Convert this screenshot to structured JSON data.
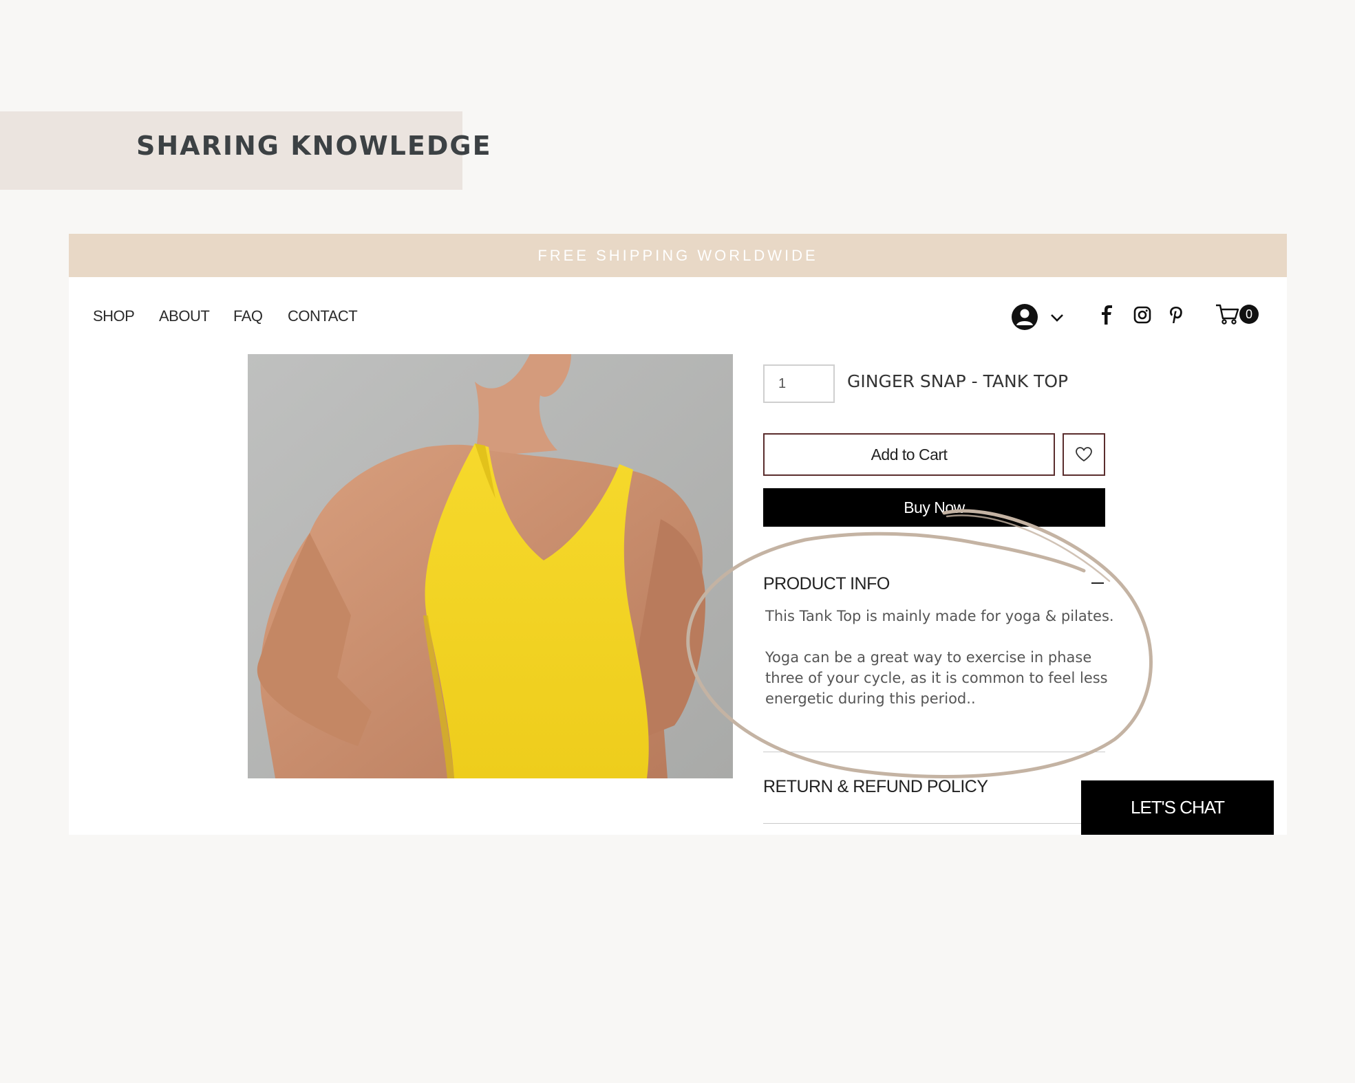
{
  "slide": {
    "title": "SHARING KNOWLEDGE"
  },
  "store": {
    "banner": "FREE SHIPPING WORLDWIDE",
    "nav": [
      "SHOP",
      "ABOUT",
      "FAQ",
      "CONTACT"
    ],
    "cart_count": "0",
    "icons": [
      "account-icon",
      "chevron-down-icon",
      "facebook-icon",
      "instagram-icon",
      "pinterest-icon",
      "cart-icon",
      "heart-icon",
      "minus-icon"
    ]
  },
  "product": {
    "quantity": "1",
    "title": "GINGER SNAP - TANK TOP",
    "add_to_cart": "Add to Cart",
    "buy_now": "Buy Now",
    "info_title": "PRODUCT INFO",
    "info_p1": "This Tank Top is mainly made for yoga & pilates.",
    "info_p2": "Yoga can be a great way to exercise in phase three of your cycle, as it is common to feel less energetic during this period..",
    "refund_title": "RETURN & REFUND POLICY"
  },
  "chat": {
    "label": "LET'S CHAT"
  },
  "colors": {
    "page_bg": "#f8f7f5",
    "tag_bg": "#ebe4df",
    "banner_bg": "#e8d8c6",
    "annotation_stroke": "#c4b3a3",
    "product_yellow": "#f2d72a"
  }
}
